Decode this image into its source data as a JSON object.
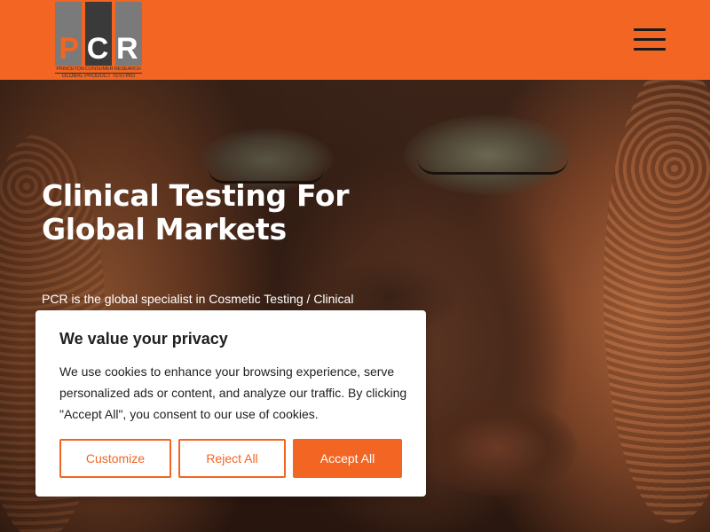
{
  "header": {
    "logo": {
      "letters": [
        "P",
        "C",
        "R"
      ],
      "subtitle_line1": "PRINCETON CONSUMER RESEARCH",
      "subtitle_line2": "GLOBAL PRODUCT TESTING"
    },
    "menu_icon": "hamburger-menu-icon",
    "brand_color": "#f26522"
  },
  "hero": {
    "title_line1": "Clinical Testing For",
    "title_line2": "Global Markets",
    "description": "PCR is the global specialist in Cosmetic Testing / Clinical"
  },
  "cookie_banner": {
    "title": "We value your privacy",
    "text": "We use cookies to enhance your browsing experience, serve personalized ads or content, and analyze our traffic. By clicking \"Accept All\", you consent to our use of cookies.",
    "buttons": {
      "customize": "Customize",
      "reject": "Reject All",
      "accept": "Accept All"
    },
    "accent_color": "#f26522"
  }
}
